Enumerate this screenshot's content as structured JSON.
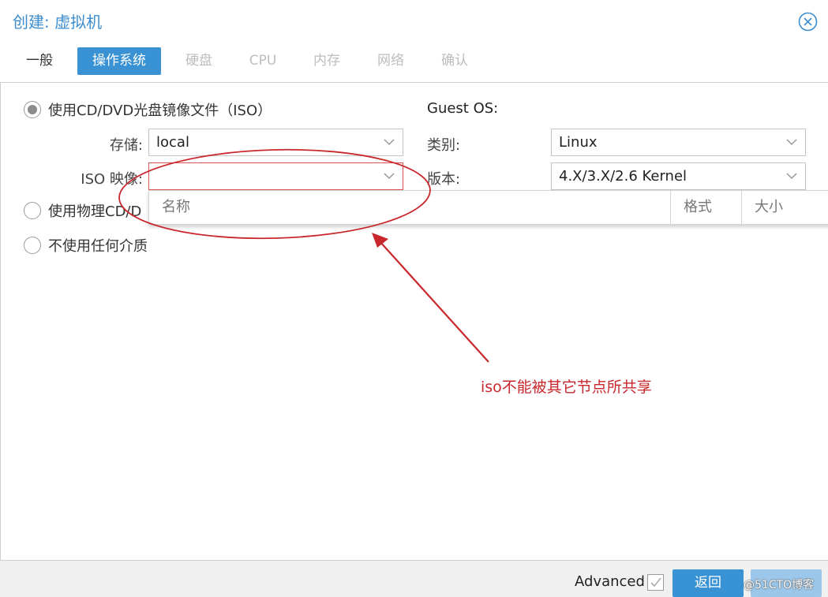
{
  "window": {
    "title": "创建: 虚拟机"
  },
  "tabs": [
    {
      "label": "一般",
      "state": "normal"
    },
    {
      "label": "操作系统",
      "state": "active"
    },
    {
      "label": "硬盘",
      "state": "disabled"
    },
    {
      "label": "CPU",
      "state": "disabled"
    },
    {
      "label": "内存",
      "state": "disabled"
    },
    {
      "label": "网络",
      "state": "disabled"
    },
    {
      "label": "确认",
      "state": "disabled"
    }
  ],
  "media": {
    "option_iso": "使用CD/DVD光盘镜像文件（ISO）",
    "option_physical": "使用物理CD/D",
    "option_none": "不使用任何介质",
    "selected": "option_iso",
    "storage_label": "存储:",
    "storage_value": "local",
    "iso_label": "ISO 映像:",
    "iso_value": ""
  },
  "guest_os": {
    "heading": "Guest OS:",
    "type_label": "类别:",
    "type_value": "Linux",
    "version_label": "版本:",
    "version_value": "4.X/3.X/2.6 Kernel"
  },
  "iso_dropdown": {
    "columns": [
      "名称",
      "格式",
      "大小"
    ]
  },
  "annotation": {
    "text": "iso不能被其它节点所共享",
    "color": "#c8282c"
  },
  "footer": {
    "advanced_label": "Advanced",
    "back_label": "返回",
    "watermark": "@51CTO博客"
  },
  "colors": {
    "accent": "#3892d4",
    "title": "#3b8dd0",
    "error_border": "#d9534f"
  }
}
